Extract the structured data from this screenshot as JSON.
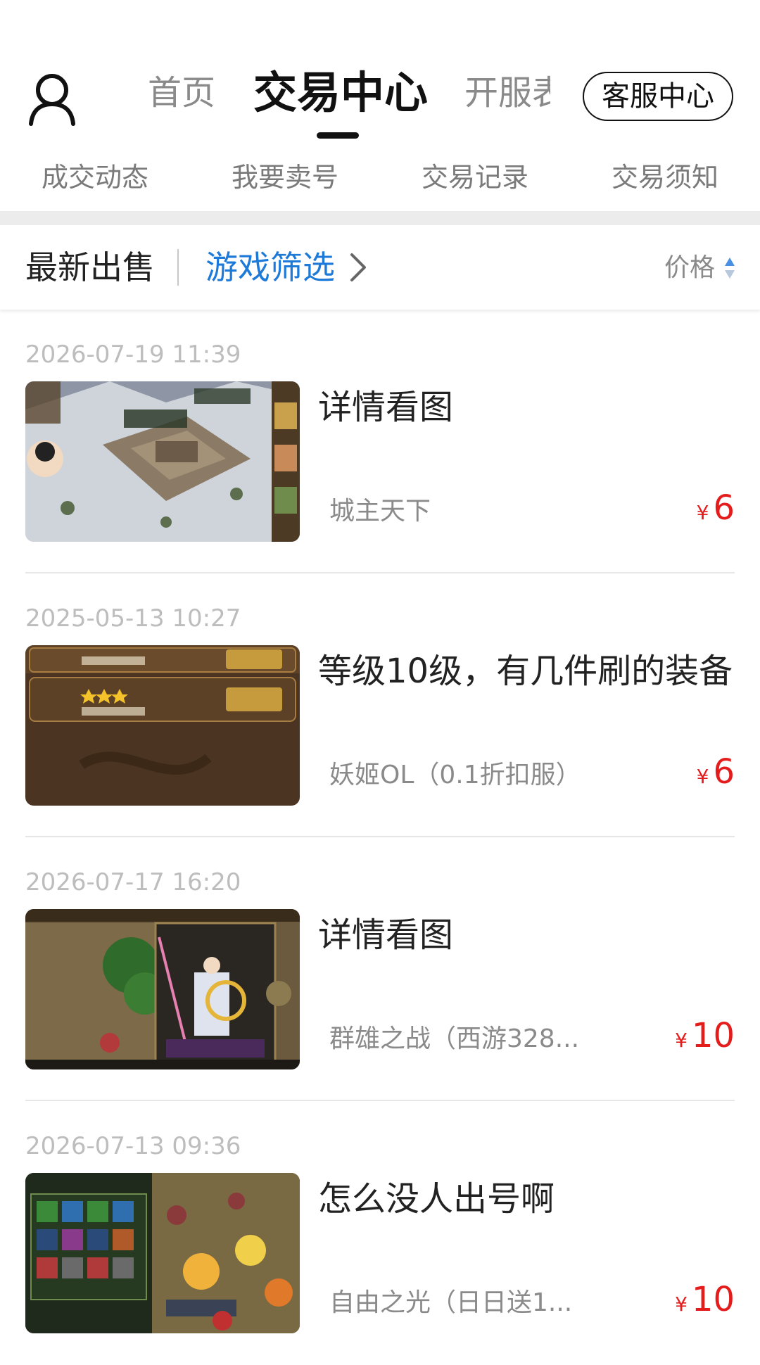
{
  "top_nav": {
    "tabs": [
      {
        "label": "首页"
      },
      {
        "label": "交易中心"
      },
      {
        "label": "开服表"
      }
    ],
    "service_button": "客服中心"
  },
  "sub_nav": [
    "成交动态",
    "我要卖号",
    "交易记录",
    "交易须知"
  ],
  "filter_bar": {
    "latest": "最新出售",
    "filter": "游戏筛选",
    "price": "价格"
  },
  "listings": [
    {
      "date": "2026-07-19 11:39",
      "title": "详情看图",
      "game": "城主天下",
      "currency": "¥",
      "price": "6"
    },
    {
      "date": "2025-05-13 10:27",
      "title": "等级10级，有几件刷的装备",
      "game": "妖姬OL（0.1折扣服）",
      "currency": "¥",
      "price": "6"
    },
    {
      "date": "2026-07-17 16:20",
      "title": "详情看图",
      "game": "群雄之战（西游328...",
      "currency": "¥",
      "price": "10"
    },
    {
      "date": "2026-07-13 09:36",
      "title": "怎么没人出号啊",
      "game": "自由之光（日日送1...",
      "currency": "¥",
      "price": "10"
    }
  ],
  "colors": {
    "accent": "#1e7ad8",
    "price": "#e51c1c"
  }
}
